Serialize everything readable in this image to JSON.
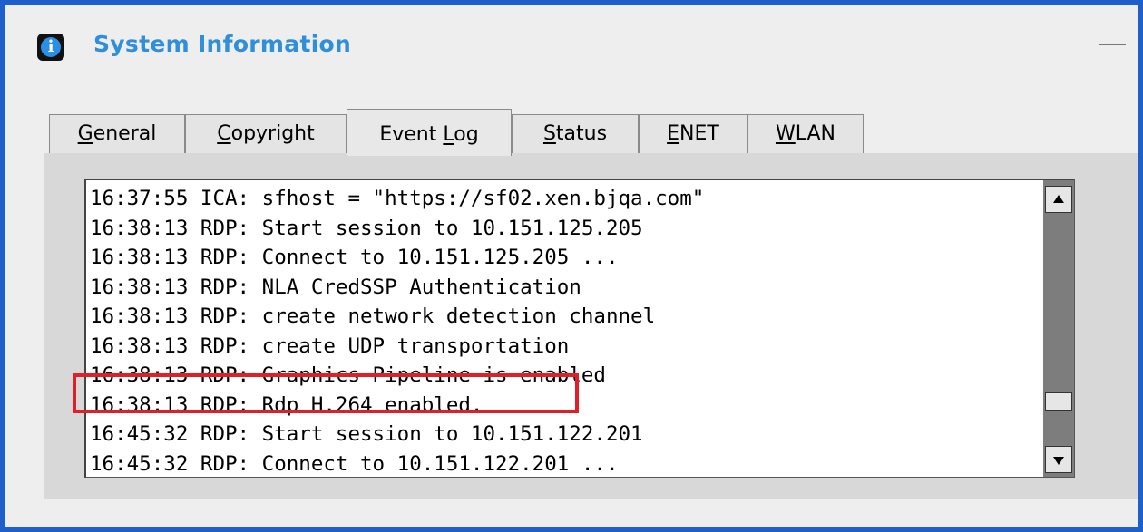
{
  "window": {
    "title": "System Information"
  },
  "tabs": [
    {
      "label": "General",
      "active": false
    },
    {
      "label": "Copyright",
      "active": false
    },
    {
      "label": "Event Log",
      "active": true
    },
    {
      "label": "Status",
      "active": false
    },
    {
      "label": "ENET",
      "active": false
    },
    {
      "label": "WLAN",
      "active": false
    }
  ],
  "event_log": {
    "lines": [
      "16:37:55 ICA: sfhost = \"https://sf02.xen.bjqa.com\"",
      "16:38:13 RDP: Start session to 10.151.125.205",
      "16:38:13 RDP: Connect to 10.151.125.205 ...",
      "16:38:13 RDP: NLA CredSSP Authentication",
      "16:38:13 RDP: create network detection channel",
      "16:38:13 RDP: create UDP transportation",
      "16:38:13 RDP: Graphics Pipeline is enabled",
      "16:38:13 RDP: Rdp H.264 enabled.",
      "16:45:32 RDP: Start session to 10.151.122.201",
      "16:45:32 RDP: Connect to 10.151.122.201 ..."
    ],
    "highlighted_line_index": 7
  },
  "colors": {
    "background": "#1f5fc9",
    "title": "#2f8fd8",
    "highlight": "#e01f26"
  }
}
